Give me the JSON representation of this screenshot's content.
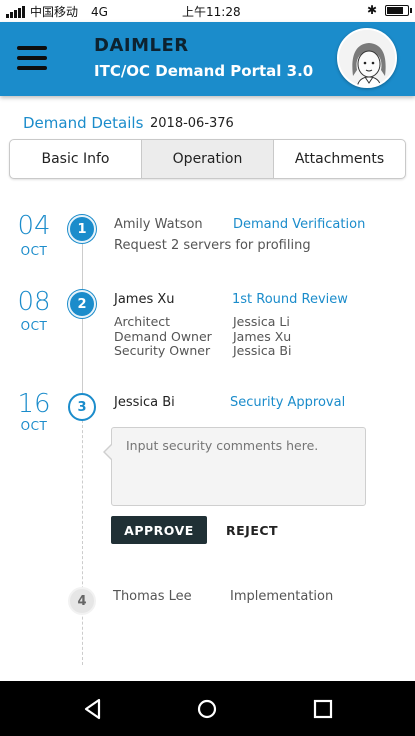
{
  "status_bar": {
    "carrier": "中国移动",
    "network": "4G",
    "time": "上午11:28"
  },
  "header": {
    "brand": "DAIMLER",
    "portal_title": "ITC/OC Demand Portal 3.0"
  },
  "demand": {
    "label": "Demand Details",
    "id": "2018-06-376"
  },
  "tabs": [
    {
      "label": "Basic Info"
    },
    {
      "label": "Operation"
    },
    {
      "label": "Attachments"
    }
  ],
  "active_tab": "Operation",
  "timeline": [
    {
      "day": "04",
      "month": "OCT",
      "number": "1",
      "person": "Amily Watson",
      "step": "Demand Verification",
      "description": "Request 2 servers for profiling"
    },
    {
      "day": "08",
      "month": "OCT",
      "number": "2",
      "person": "James Xu",
      "step": "1st Round Review",
      "roles": [
        {
          "role": "Architect",
          "name": "Jessica Li"
        },
        {
          "role": "Demand Owner",
          "name": "James Xu"
        },
        {
          "role": "Security Owner",
          "name": "Jessica Bi"
        }
      ]
    },
    {
      "day": "16",
      "month": "OCT",
      "number": "3",
      "person": "Jessica Bi",
      "step": "Security Approval"
    },
    {
      "number": "4",
      "person": "Thomas Lee",
      "step": "Implementation"
    }
  ],
  "comment": {
    "placeholder": "Input security comments here."
  },
  "actions": {
    "approve": "APPROVE",
    "reject": "REJECT"
  },
  "colors": {
    "accent": "#1b8ccb",
    "dark_button": "#203035"
  }
}
